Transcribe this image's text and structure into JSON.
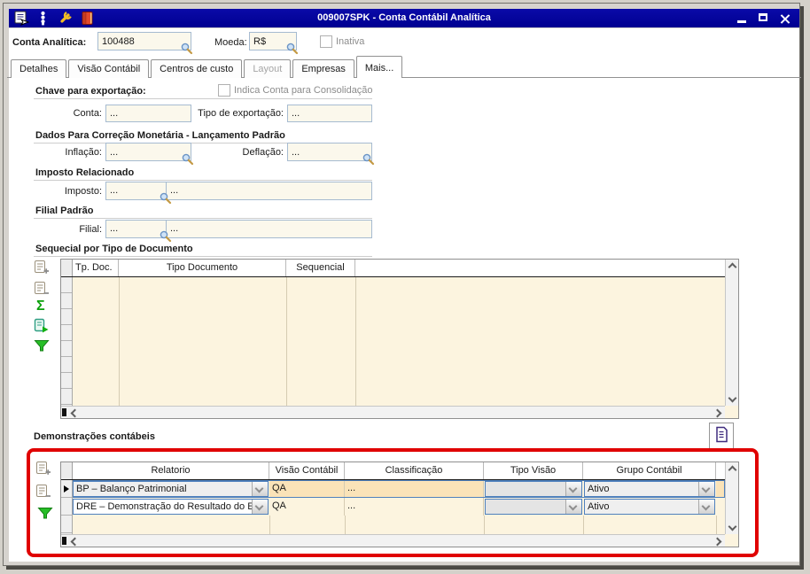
{
  "window": {
    "title": "009007SPK - Conta Contábil Analítica",
    "titlebar_icons": [
      "new-form-icon",
      "totem-icon",
      "wrench-icon",
      "notebook-icon"
    ],
    "controls": [
      "minimize",
      "maximize",
      "close"
    ]
  },
  "header": {
    "conta_label": "Conta Analítica:",
    "conta_value": "100488",
    "moeda_label": "Moeda:",
    "moeda_value": "R$",
    "inativa_label": "Inativa"
  },
  "tabs": [
    "Detalhes",
    "Visão Contábil",
    "Centros de custo",
    "Layout",
    "Empresas",
    "Mais..."
  ],
  "chave": {
    "title": "Chave para exportação:",
    "consolidacao_label": "Indica Conta para Consolidação",
    "conta_label": "Conta:",
    "conta_value": "...",
    "tipo_label": "Tipo de exportação:",
    "tipo_value": "..."
  },
  "correcao": {
    "title": "Dados Para Correção Monetária - Lançamento Padrão",
    "inflacao_label": "Inflação:",
    "inflacao_value": "...",
    "deflacao_label": "Deflação:",
    "deflacao_value": "..."
  },
  "imposto": {
    "title": "Imposto Relacionado",
    "label": "Imposto:",
    "code": "...",
    "desc": "..."
  },
  "filial": {
    "title": "Filial Padrão",
    "label": "Filial:",
    "code": "...",
    "desc": "..."
  },
  "sequencial": {
    "title": "Sequecial por Tipo de Documento",
    "columns": [
      "Tp. Doc.",
      "Tipo Documento",
      "Sequencial"
    ],
    "toolbar_icons": [
      "add-row-icon",
      "remove-row-icon",
      "sum-icon",
      "export-icon",
      "filter-icon"
    ]
  },
  "demonstracoes": {
    "title": "Demonstrações contábeis",
    "report_button_icon": "report-icon",
    "toolbar_icons": [
      "add-row-icon",
      "remove-row-icon",
      "filter-icon"
    ],
    "columns": [
      "Relatorio",
      "Visão Contábil",
      "Classificação",
      "Tipo Visão",
      "Grupo Contábil"
    ],
    "rows": [
      {
        "relatorio": "BP – Balanço Patrimonial",
        "visao": "QA",
        "classificacao": "...",
        "tipo_visao": "",
        "grupo": "Ativo"
      },
      {
        "relatorio": "DRE – Demonstração do Resultado do Ex",
        "visao": "QA",
        "classificacao": "...",
        "tipo_visao": "",
        "grupo": "Ativo"
      }
    ]
  },
  "colors": {
    "titlebar": "#0202A0",
    "field_bg": "#FBF8EC",
    "field_border": "#A6BBD1",
    "grid_bg": "#FCF4DF",
    "selected_row_bg": "#FAE3B8",
    "focus_border": "#4F81BD",
    "annotation_red": "#E00000"
  }
}
